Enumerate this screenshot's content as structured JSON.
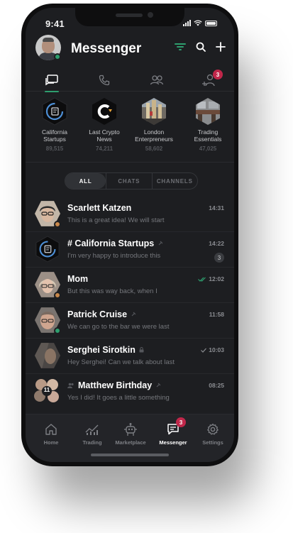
{
  "status": {
    "time": "9:41"
  },
  "header": {
    "title": "Messenger"
  },
  "tabs": [
    {
      "icon": "chat-bubbles-icon",
      "active": true
    },
    {
      "icon": "phone-icon",
      "active": false
    },
    {
      "icon": "contacts-icon",
      "active": false
    },
    {
      "icon": "add-contact-icon",
      "active": false,
      "badge": "3"
    }
  ],
  "channels": [
    {
      "name_line1": "California",
      "name_line2": "Startups",
      "count": "89,515"
    },
    {
      "name_line1": "Last Crypto",
      "name_line2": "News",
      "count": "74,211"
    },
    {
      "name_line1": "London",
      "name_line2": "Enterpreneurs",
      "count": "58,602"
    },
    {
      "name_line1": "Trading",
      "name_line2": "Essentials",
      "count": "47,025"
    }
  ],
  "filters": {
    "all": "ALL",
    "chats": "CHATS",
    "channels": "CHANNELS"
  },
  "chats": [
    {
      "name": "Scarlett Katzen",
      "message": "This is a great idea! We will start",
      "time": "14:31",
      "status_color": "#c8874a"
    },
    {
      "name": "# California Startups",
      "message": "I'm very happy to introduce this",
      "time": "14:22",
      "unread": "3"
    },
    {
      "name": "Mom",
      "message": "But this was way back, when I",
      "time": "12:02",
      "status_color": "#c8874a",
      "read": true
    },
    {
      "name": "Patrick Cruise",
      "message": "We can go to the bar we were last",
      "time": "11:58",
      "status_color": "#2e9e6e"
    },
    {
      "name": "Serghei Sirotkin",
      "message": "Hey Serghei! Can we talk about last",
      "time": "10:03",
      "sent": true
    },
    {
      "name": "Matthew Birthday",
      "message": "Yes I did! It goes a little something",
      "time": "08:25",
      "group_count": "11"
    }
  ],
  "nav": {
    "home": "Home",
    "trading": "Trading",
    "marketplace": "Marketplace",
    "messenger": "Messenger",
    "messenger_badge": "3",
    "settings": "Settings"
  },
  "colors": {
    "accent": "#2e9e6e",
    "badge": "#c0274a",
    "background": "#1d1e21"
  }
}
